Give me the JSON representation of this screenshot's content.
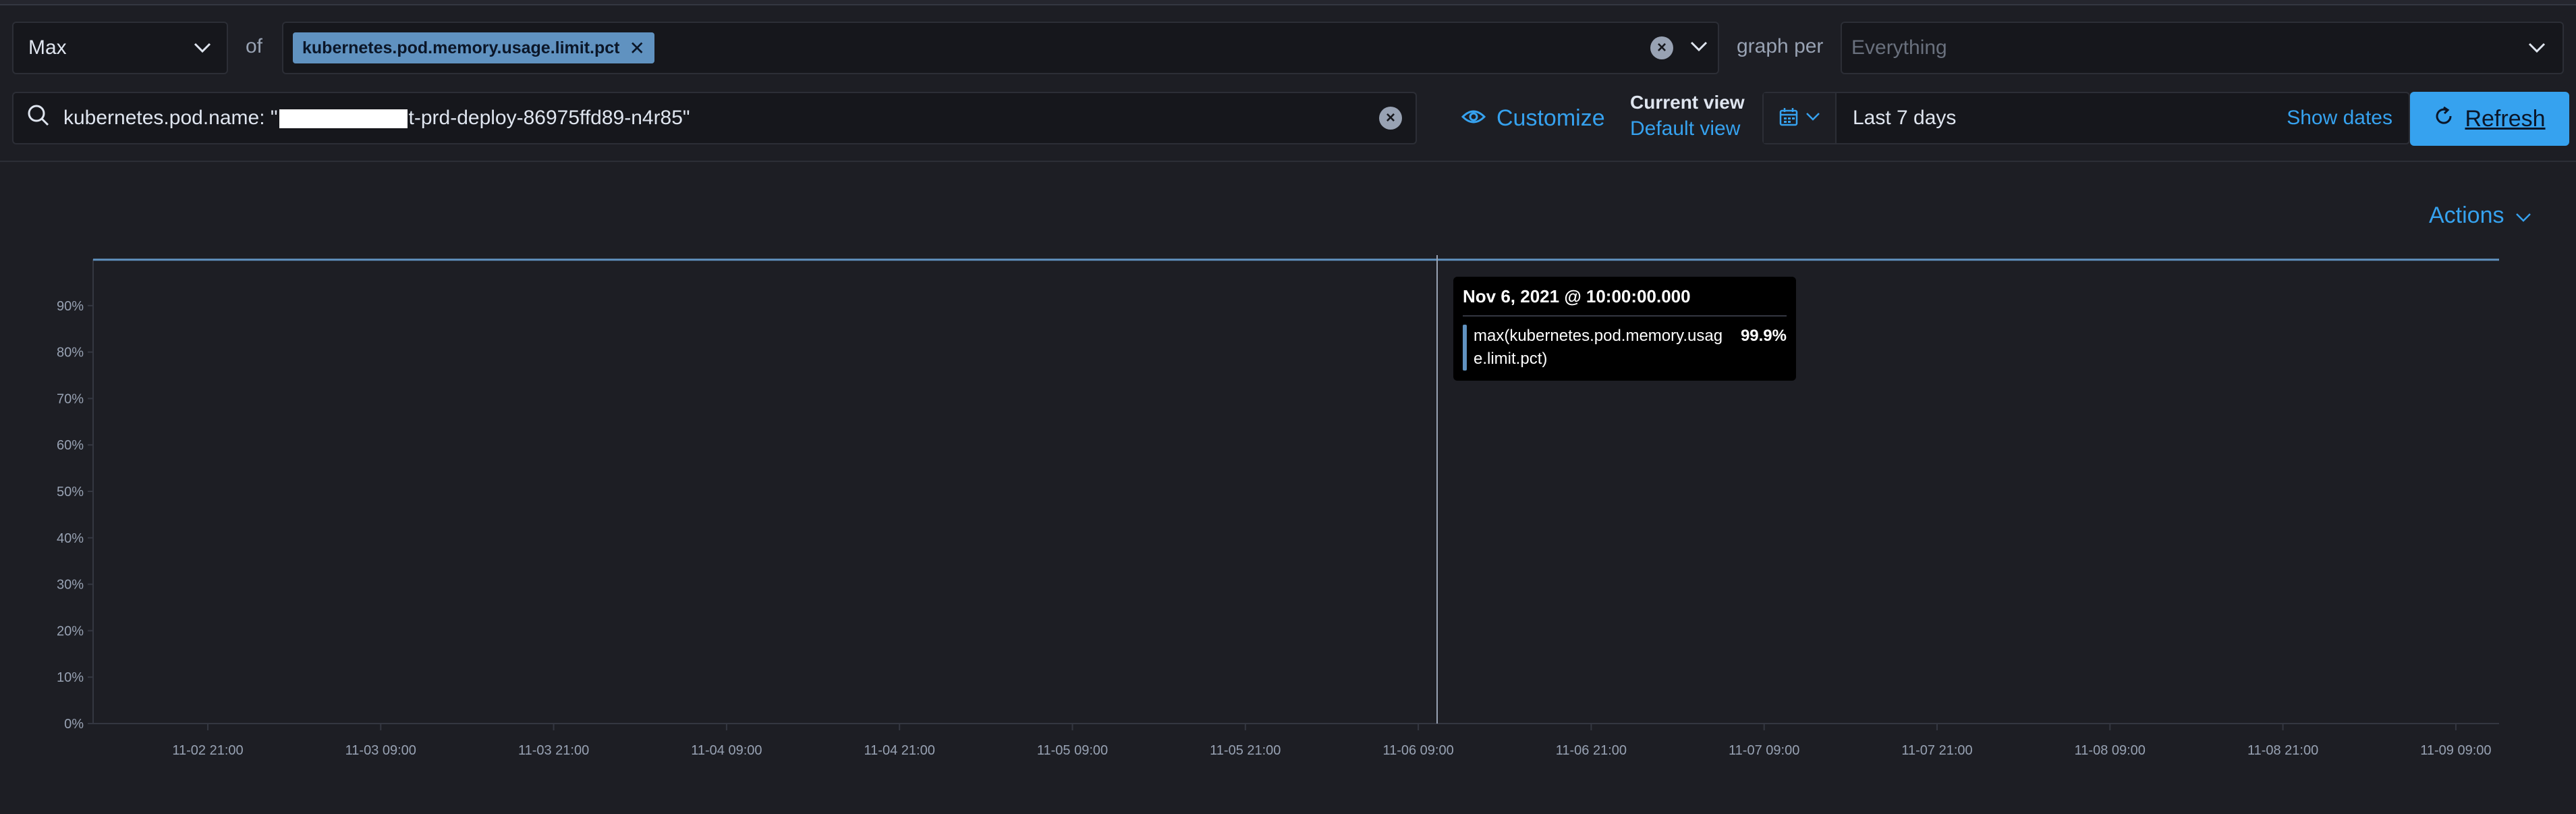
{
  "toolbar": {
    "aggregation": "Max",
    "of_label": "of",
    "metric": "kubernetes.pod.memory.usage.limit.pct",
    "graph_per_label": "graph per",
    "graph_per_placeholder": "Everything"
  },
  "search": {
    "query_prefix": "kubernetes.pod.name: \"",
    "query_suffix": "t-prd-deploy-86975ffd89-n4r85\""
  },
  "view": {
    "customize_label": "Customize",
    "current_view_title": "Current view",
    "current_view_value": "Default view"
  },
  "date": {
    "range_label": "Last 7 days",
    "show_dates_label": "Show dates",
    "refresh_label": "Refresh"
  },
  "actions_label": "Actions",
  "colors": {
    "series": "#6092c0",
    "accent": "#36a2ef",
    "background": "#1d1e24"
  },
  "tooltip": {
    "timestamp": "Nov 6, 2021 @ 10:00:00.000",
    "series_name": "max(kubernetes.pod.memory.usage.limit.pct)",
    "series_value": "99.9%"
  },
  "chart_data": {
    "type": "line",
    "title": "",
    "xlabel": "",
    "ylabel": "",
    "y_ticks": [
      "0%",
      "10%",
      "20%",
      "30%",
      "40%",
      "50%",
      "60%",
      "70%",
      "80%",
      "90%"
    ],
    "x_ticks": [
      "11-02 21:00",
      "11-03 09:00",
      "11-03 21:00",
      "11-04 09:00",
      "11-04 21:00",
      "11-05 09:00",
      "11-05 21:00",
      "11-06 09:00",
      "11-06 21:00",
      "11-07 09:00",
      "11-07 21:00",
      "11-08 09:00",
      "11-08 21:00",
      "11-09 09:00"
    ],
    "ylim": [
      0,
      1
    ],
    "grid": false,
    "cursor_x": "2021-11-06 10:00",
    "series": [
      {
        "name": "max(kubernetes.pod.memory.usage.limit.pct)",
        "x": [
          "2021-11-02 10:00",
          "2021-11-09 10:00"
        ],
        "y": [
          0.999,
          0.999
        ]
      }
    ]
  }
}
